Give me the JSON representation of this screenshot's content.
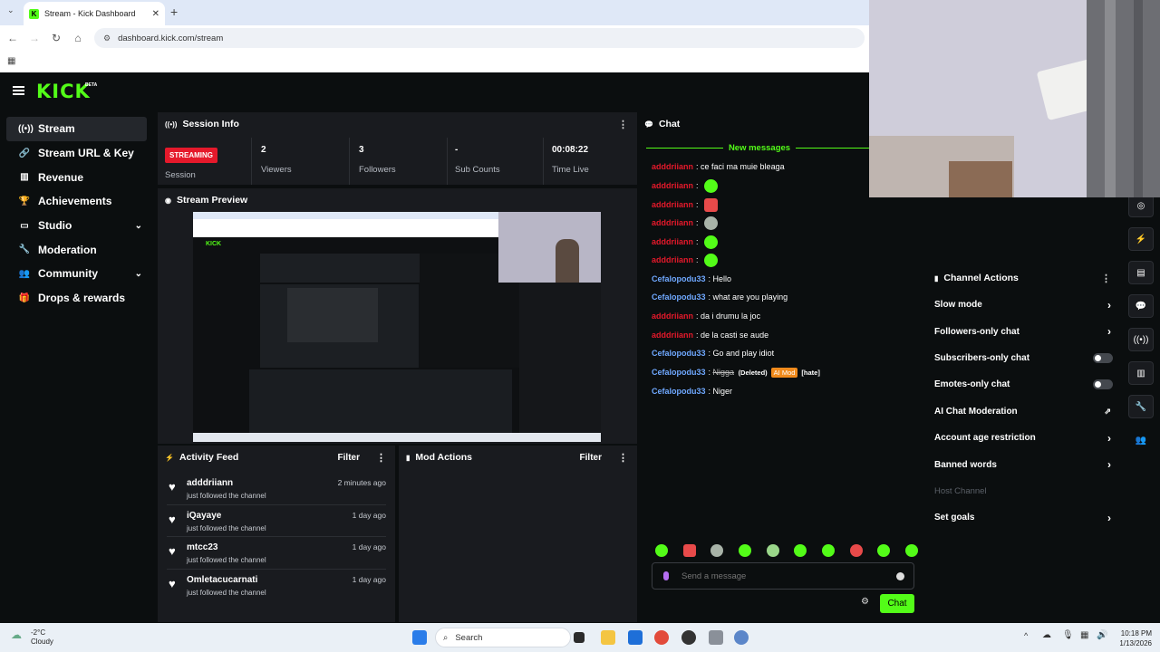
{
  "browser": {
    "tab_title": "Stream - Kick Dashboard",
    "url": "dashboard.kick.com/stream"
  },
  "brand": {
    "logo": "KICK",
    "beta": "BETA",
    "accent": "#53fc18"
  },
  "sidebar": {
    "items": [
      {
        "label": "Stream",
        "icon": "broadcast-icon"
      },
      {
        "label": "Stream URL & Key",
        "icon": "link-icon"
      },
      {
        "label": "Revenue",
        "icon": "revenue-icon"
      },
      {
        "label": "Achievements",
        "icon": "trophy-icon"
      },
      {
        "label": "Studio",
        "icon": "studio-icon"
      },
      {
        "label": "Moderation",
        "icon": "wrench-icon"
      },
      {
        "label": "Community",
        "icon": "community-icon"
      },
      {
        "label": "Drops & rewards",
        "icon": "gift-icon"
      }
    ]
  },
  "session": {
    "title": "Session Info",
    "status": "STREAMING",
    "status_label": "Session",
    "stats": [
      {
        "value": "2",
        "label": "Viewers"
      },
      {
        "value": "3",
        "label": "Followers"
      },
      {
        "value": "-",
        "label": "Sub Counts"
      },
      {
        "value": "00:08:22",
        "label": "Time Live"
      }
    ]
  },
  "preview": {
    "title": "Stream Preview"
  },
  "activity": {
    "title": "Activity Feed",
    "filter": "Filter",
    "items": [
      {
        "name": "adddriiann",
        "sub": "just followed the channel",
        "time": "2 minutes ago"
      },
      {
        "name": "iQayaye",
        "sub": "just followed the channel",
        "time": "1 day ago"
      },
      {
        "name": "mtcc23",
        "sub": "just followed the channel",
        "time": "1 day ago"
      },
      {
        "name": "Omletacucarnati",
        "sub": "just followed the channel",
        "time": "1 day ago"
      }
    ]
  },
  "mod": {
    "title": "Mod Actions",
    "filter": "Filter"
  },
  "chat": {
    "title": "Chat",
    "new_messages": "New messages",
    "send_placeholder": "Send a message",
    "send_button": "Chat",
    "messages": [
      {
        "user": "adddriiann",
        "text": "ce faci ma muie bleaga"
      },
      {
        "user": "adddriiann",
        "text": ""
      },
      {
        "user": "adddriiann",
        "text": ""
      },
      {
        "user": "adddriiann",
        "text": ""
      },
      {
        "user": "adddriiann",
        "text": ""
      },
      {
        "user": "adddriiann",
        "text": ""
      },
      {
        "user": "Cefalopodu33",
        "text": "Hello"
      },
      {
        "user": "Cefalopodu33",
        "text": "what are you playing"
      },
      {
        "user": "adddriiann",
        "text": "da i drumu la joc"
      },
      {
        "user": "adddriiann",
        "text": "de la casti se aude"
      },
      {
        "user": "Cefalopodu33",
        "text": "Go and play idiot"
      },
      {
        "user": "Cefalopodu33",
        "text": "Nigga",
        "deleted": "(Deleted)",
        "aimod": "AI Mod",
        "flag": "[hate]"
      },
      {
        "user": "Cefalopodu33",
        "text": "Niger"
      }
    ]
  },
  "channel_actions": {
    "title": "Channel Actions",
    "items": [
      {
        "label": "Slow mode",
        "kind": "arrow"
      },
      {
        "label": "Followers-only chat",
        "kind": "arrow"
      },
      {
        "label": "Subscribers-only chat",
        "kind": "toggle"
      },
      {
        "label": "Emotes-only chat",
        "kind": "toggle"
      },
      {
        "label": "AI Chat Moderation",
        "kind": "external"
      },
      {
        "label": "Account age restriction",
        "kind": "arrow"
      },
      {
        "label": "Banned words",
        "kind": "arrow"
      },
      {
        "label": "Host Channel",
        "kind": "disabled"
      },
      {
        "label": "Set goals",
        "kind": "arrow"
      }
    ]
  },
  "taskbar": {
    "temp": "-2°C",
    "weather": "Cloudy",
    "search": "Search",
    "time": "10:18 PM",
    "date": "1/13/2026"
  },
  "colors": {
    "user_red": "#e5192b",
    "user_blue": "#6fa8ff",
    "live_red": "#e5192b",
    "ai_mod": "#f08a1c"
  }
}
